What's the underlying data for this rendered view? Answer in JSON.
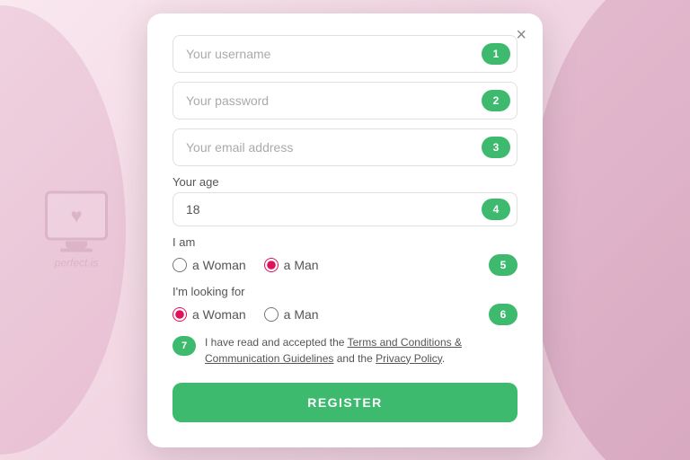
{
  "background": {
    "color": "#f3d8e4"
  },
  "watermark": {
    "text": "perfect.is"
  },
  "modal": {
    "close_label": "×",
    "fields": {
      "username": {
        "placeholder": "Your username",
        "step": "1",
        "value": ""
      },
      "password": {
        "placeholder": "Your password",
        "step": "2",
        "value": ""
      },
      "email": {
        "placeholder": "Your email address",
        "step": "3",
        "value": ""
      },
      "age": {
        "label": "Your age",
        "step": "4",
        "value": "18"
      }
    },
    "iam": {
      "label": "I am",
      "step": "5",
      "options": [
        {
          "value": "woman",
          "label": "a Woman",
          "checked": false
        },
        {
          "value": "man",
          "label": "a Man",
          "checked": true
        }
      ]
    },
    "looking_for": {
      "label": "I'm looking for",
      "step": "6",
      "options": [
        {
          "value": "woman",
          "label": "a Woman",
          "checked": true
        },
        {
          "value": "man",
          "label": "a Man",
          "checked": false
        }
      ]
    },
    "terms": {
      "step": "7",
      "text_before": "I have read and accepted the ",
      "link1_text": "Terms and Conditions & Communication Guidelines",
      "text_middle": " and the ",
      "link2_text": "Privacy Policy",
      "text_after": "."
    },
    "register_button": "REGISTER"
  }
}
